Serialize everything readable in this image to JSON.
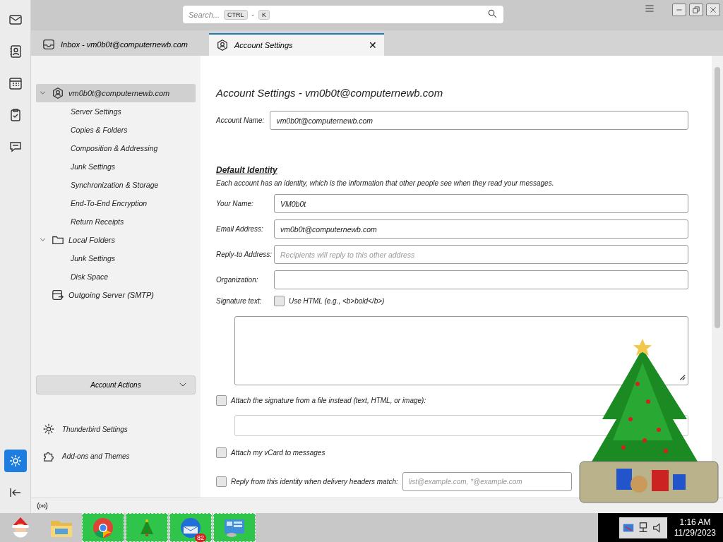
{
  "spaces_toolbar": [
    {
      "kind": "mail",
      "selected": false
    },
    {
      "kind": "contacts",
      "selected": false
    },
    {
      "kind": "calendar",
      "selected": false
    },
    {
      "kind": "tasks",
      "selected": false
    },
    {
      "kind": "chat",
      "selected": false
    }
  ],
  "spaces_bottom": [
    {
      "kind": "settings",
      "selected": true
    },
    {
      "kind": "collapse",
      "selected": false
    }
  ],
  "search": {
    "placeholder": "Search...",
    "keys": [
      "CTRL",
      "K"
    ],
    "separator": "-"
  },
  "tabs": [
    {
      "kind": "mail",
      "label": "Inbox - vm0b0t@computernewb.com",
      "selected": false
    },
    {
      "kind": "account",
      "label": "Account Settings",
      "selected": true,
      "close": "✕"
    }
  ],
  "account_tree": [
    {
      "kind": "account",
      "label": "vm0b0t@computernewb.com",
      "expanded": true,
      "selected": true,
      "children": [
        {
          "label": "Server Settings"
        },
        {
          "label": "Copies & Folders"
        },
        {
          "label": "Composition & Addressing"
        },
        {
          "label": "Junk Settings"
        },
        {
          "label": "Synchronization & Storage"
        },
        {
          "label": "End-To-End Encryption"
        },
        {
          "label": "Return Receipts"
        }
      ]
    },
    {
      "kind": "folder",
      "label": "Local Folders",
      "expanded": true,
      "selected": false,
      "children": [
        {
          "label": "Junk Settings"
        },
        {
          "label": "Disk Space"
        }
      ]
    },
    {
      "kind": "outgoing",
      "label": "Outgoing Server (SMTP)",
      "selected": false
    }
  ],
  "account_actions": "Account Actions",
  "sidebar_links": [
    {
      "kind": "settings",
      "label": "Thunderbird Settings"
    },
    {
      "kind": "addons",
      "label": "Add-ons and Themes"
    }
  ],
  "page": {
    "title": "Account Settings - vm0b0t@computernewb.com",
    "account_name_label": "Account Name:",
    "account_name": "vm0b0t@computernewb.com",
    "section": "Default Identity",
    "description": "Each account has an identity, which is the information that other people see when they read your messages.",
    "fields": [
      {
        "label": "Your Name:",
        "value": "VM0b0t"
      },
      {
        "label": "Email Address:",
        "value": "vm0b0t@computernewb.com"
      },
      {
        "label": "Reply-to Address:",
        "placeholder": "Recipients will reply to this other address"
      },
      {
        "label": "Organization:"
      }
    ],
    "signature_label": "Signature text:",
    "use_html": {
      "label": "Use HTML (e.g., <b>bold</b>)",
      "checked": false
    },
    "attach_file": {
      "label": "Attach the signature from a file instead (text, HTML, or image):",
      "checked": false
    },
    "attach_vcard": {
      "label": "Attach my vCard to messages",
      "checked": false
    },
    "reply_from": {
      "label": "Reply from this identity when delivery headers match:",
      "checked": false,
      "placeholder": "list@example.com, *@example.com"
    }
  },
  "taskbar": {
    "apps": [
      {
        "kind": "santa"
      },
      {
        "kind": "explorer"
      },
      {
        "kind": "chrome"
      },
      {
        "kind": "tree"
      },
      {
        "kind": "thunderbird",
        "badge": "82"
      },
      {
        "kind": "control"
      }
    ],
    "time": "1:16 AM",
    "date": "11/29/2023"
  }
}
